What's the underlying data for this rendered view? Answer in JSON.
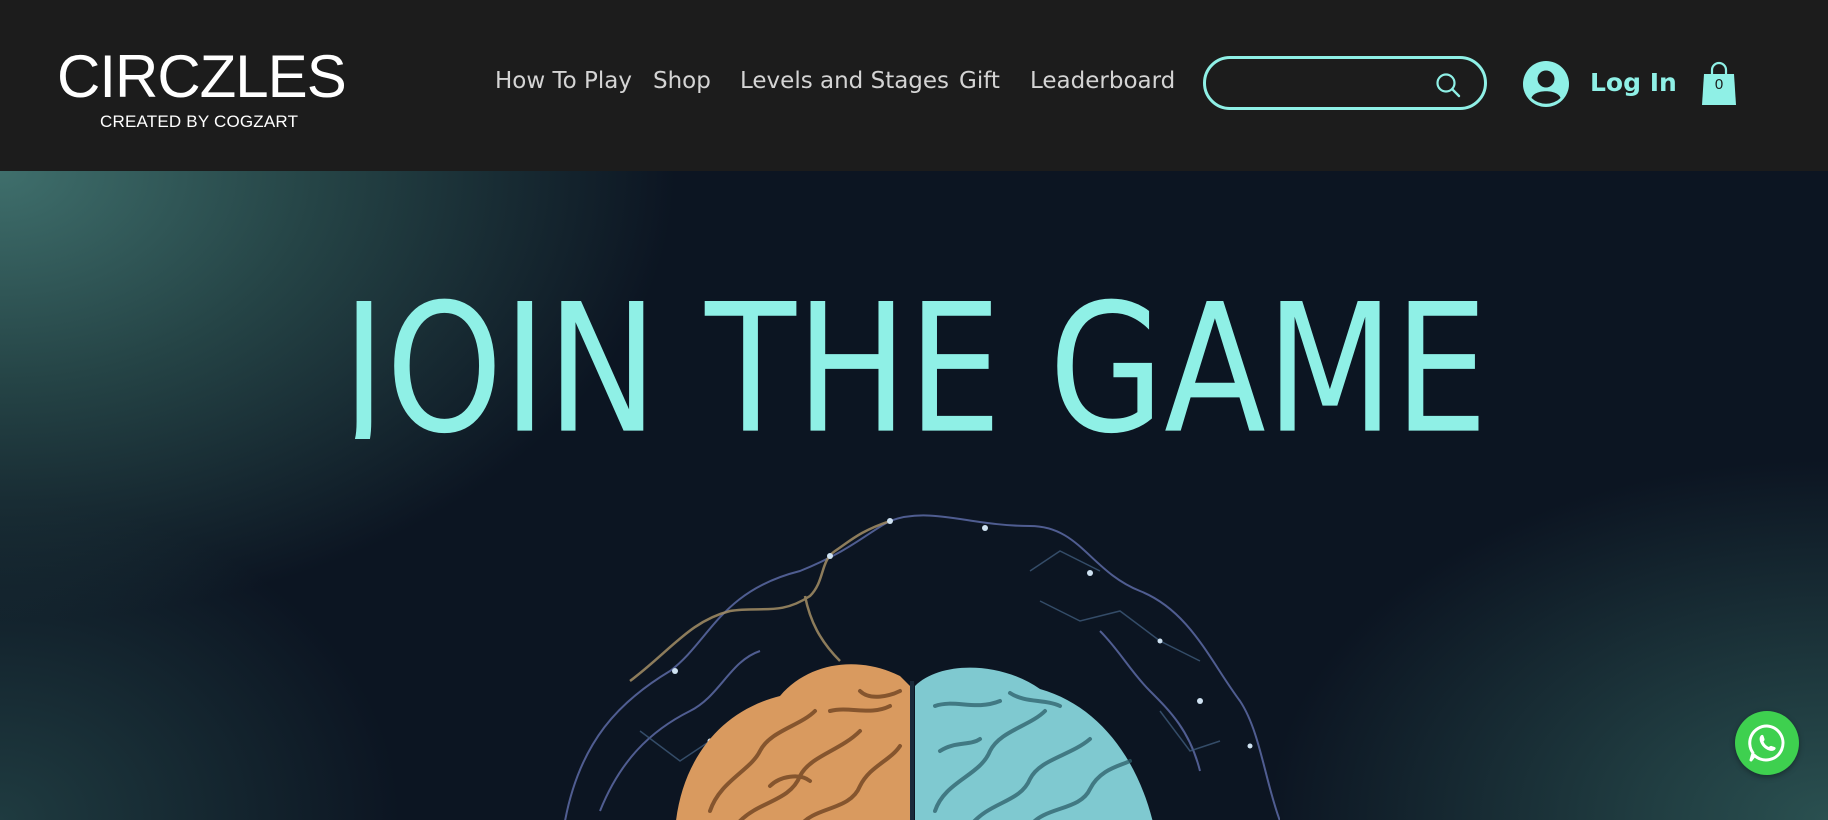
{
  "header": {
    "logo": {
      "title": "CIRCZLES",
      "subtitle": "CREATED BY COGZART"
    },
    "nav": [
      {
        "label": "How To Play"
      },
      {
        "label": "Shop"
      },
      {
        "label": "Levels and Stages"
      },
      {
        "label": "Gift"
      },
      {
        "label": "Leaderboard"
      }
    ],
    "search": {
      "value": "",
      "placeholder": "",
      "icon": "search-icon"
    },
    "login": {
      "label": "Log In",
      "icon": "user-avatar-icon"
    },
    "cart": {
      "count": "0",
      "icon": "shopping-bag-icon"
    }
  },
  "hero": {
    "title": "JOIN THE GAME",
    "image": "brain-network-illustration"
  },
  "floating": {
    "icon": "whatsapp-icon"
  },
  "colors": {
    "accent": "#8ff0e6",
    "header_bg": "#1c1c1c",
    "nav_text": "#d4d4d4",
    "whatsapp": "#3ed04f",
    "brain_left": "#e3a56c",
    "brain_right": "#8fd6dc"
  }
}
